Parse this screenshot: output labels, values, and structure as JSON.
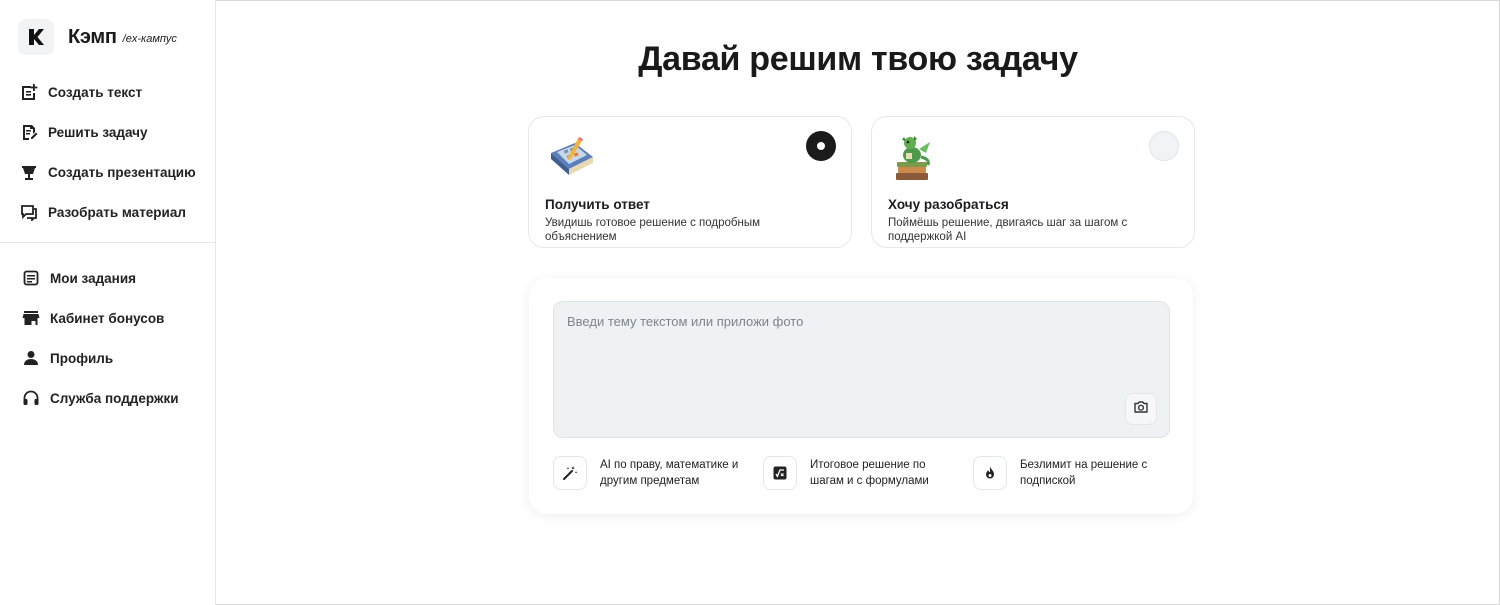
{
  "brand": {
    "name": "Кэмп",
    "sub": "/ex-кампус"
  },
  "sidebar": {
    "primary": [
      {
        "label": "Создать текст",
        "icon": "document-plus-icon"
      },
      {
        "label": "Решить задачу",
        "icon": "edit-document-icon"
      },
      {
        "label": "Создать презентацию",
        "icon": "presentation-icon"
      },
      {
        "label": "Разобрать материал",
        "icon": "chat-bubbles-icon"
      }
    ],
    "secondary": [
      {
        "label": "Мои задания",
        "icon": "list-document-icon"
      },
      {
        "label": "Кабинет бонусов",
        "icon": "store-icon"
      },
      {
        "label": "Профиль",
        "icon": "person-icon"
      },
      {
        "label": "Служба поддержки",
        "icon": "headphones-icon"
      }
    ]
  },
  "main": {
    "title": "Давай решим твою задачу",
    "modes": [
      {
        "title": "Получить ответ",
        "desc": "Увидишь готовое решение с подробным объяснением",
        "selected": true,
        "icon": "calculator-book-icon"
      },
      {
        "title": "Хочу разобраться",
        "desc": "Поймёшь решение, двигаясь шаг за шагом с поддержкой AI",
        "selected": false,
        "icon": "dragon-books-icon"
      }
    ],
    "input": {
      "placeholder": "Введи тему текстом или приложи фото",
      "value": ""
    },
    "features": [
      {
        "text": "AI по праву, математике и другим предметам",
        "icon": "magic-wand-icon"
      },
      {
        "text": "Итоговое решение по шагам и с формулами",
        "icon": "formula-icon"
      },
      {
        "text": "Безлимит на решение с подпиской",
        "icon": "flame-icon"
      }
    ]
  }
}
